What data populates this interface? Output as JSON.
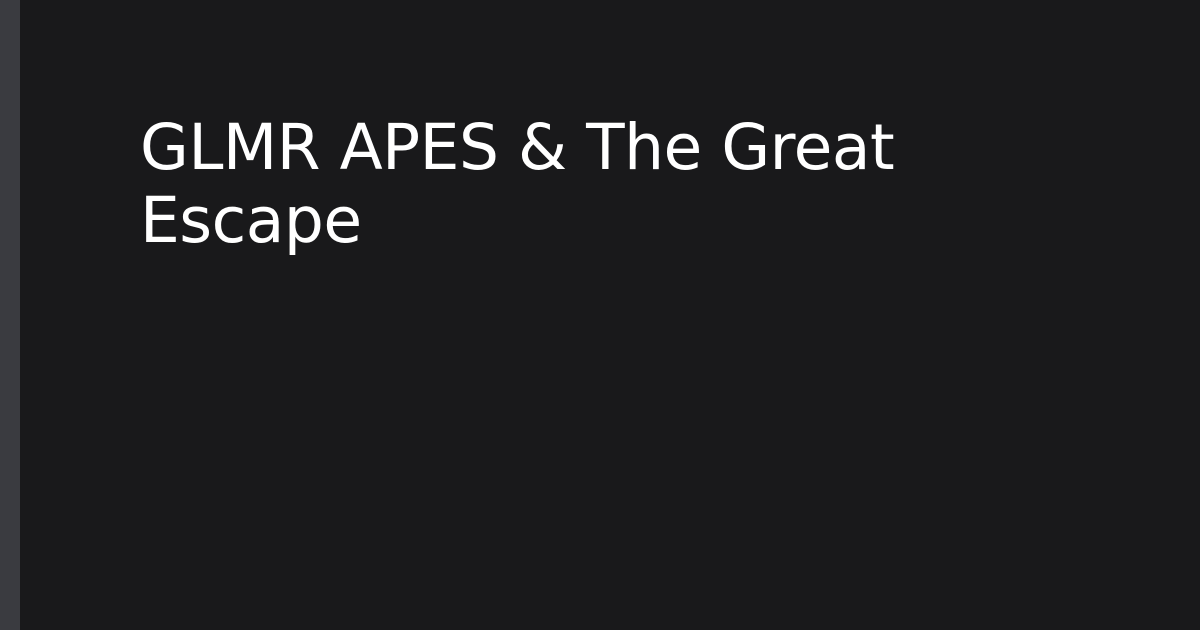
{
  "page": {
    "title": "GLMR APES & The Great Escape"
  },
  "colors": {
    "background": "#19191b",
    "accent_bar": "#3a3b40",
    "title_text": "#ffffff"
  }
}
